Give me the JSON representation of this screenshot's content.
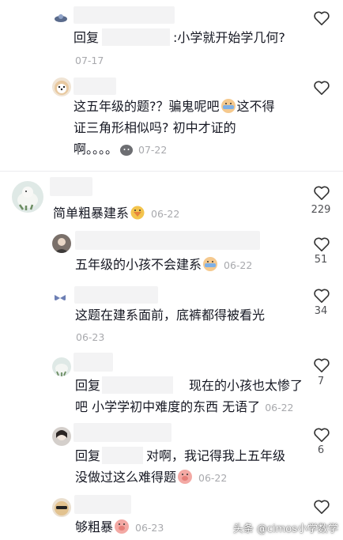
{
  "comments": [
    {
      "reply_prefix": "回复",
      "text": ":小学就开始学几何?",
      "date": "07-17",
      "icons": {
        "avatar": "geometry-avatar-icon",
        "like": "heart-outline-icon"
      }
    },
    {
      "line1": "这五年级的题?？骗鬼呢吧",
      "line1b": "这不得",
      "line2": "证三角形相似吗? 初中才证的",
      "line3": "啊。。。。",
      "date": "07-22",
      "icons": {
        "avatar": "puppy-avatar-icon",
        "like": "heart-outline-icon"
      }
    },
    {
      "text": "简单粗暴建系",
      "date": "06-22",
      "like_count": "229",
      "icons": {
        "avatar": "pigeon-avatar-icon",
        "like": "heart-outline-icon"
      }
    },
    {
      "text": "五年级的小孩不会建系",
      "date": "06-22",
      "like_count": "51"
    },
    {
      "text": "这题在建系面前，底裤都得被看光",
      "date": "06-23",
      "like_count": "34"
    },
    {
      "reply_prefix": "回复",
      "line1": "现在的小孩也太惨了",
      "line2": "吧 小学学初中难度的东西 无语了",
      "date": "06-22",
      "like_count": "7"
    },
    {
      "reply_prefix": "回复",
      "line1": "对啊，我记得我上五年级",
      "line2": "没做过这么难得题",
      "date": "06-22",
      "like_count": "6"
    },
    {
      "text": "够粗暴",
      "date": "06-23"
    }
  ],
  "watermark": "头条 @cimos小学数学",
  "colors": {
    "text": "#161823",
    "meta": "#a8a9ad",
    "blur": "#f3f3f4"
  }
}
